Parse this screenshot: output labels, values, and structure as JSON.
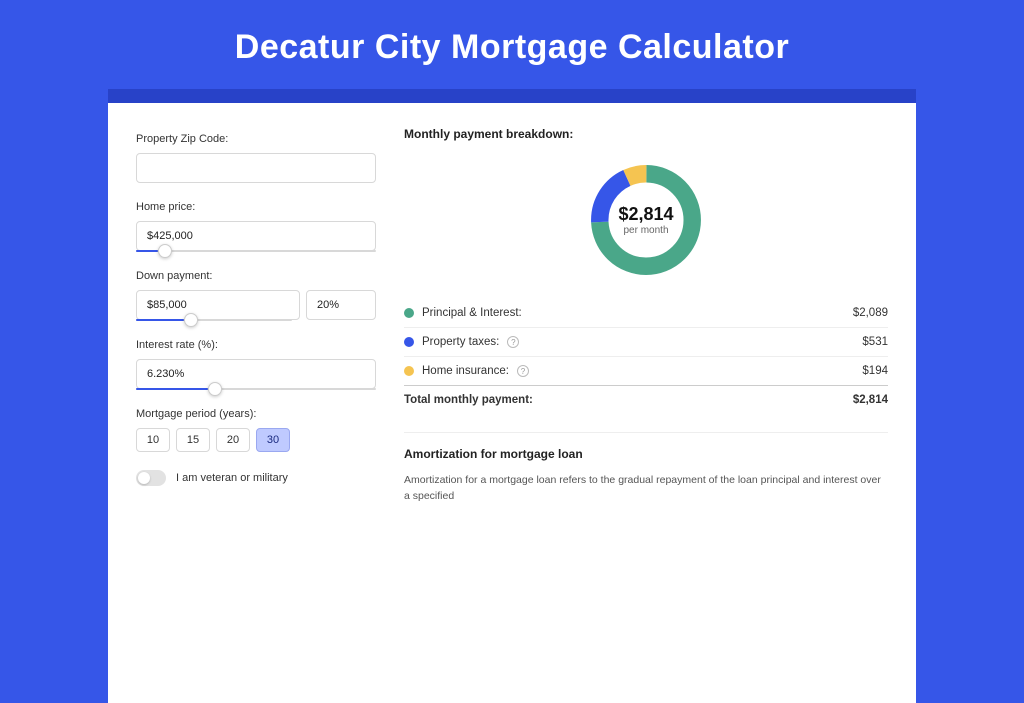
{
  "title": "Decatur City Mortgage Calculator",
  "form": {
    "zip": {
      "label": "Property Zip Code:",
      "value": ""
    },
    "price": {
      "label": "Home price:",
      "value": "$425,000",
      "slider_pct": 9
    },
    "down": {
      "label": "Down payment:",
      "value": "$85,000",
      "pct": "20%",
      "slider_pct": 20
    },
    "rate": {
      "label": "Interest rate (%):",
      "value": "6.230%",
      "slider_pct": 30
    },
    "period": {
      "label": "Mortgage period (years):",
      "options": [
        "10",
        "15",
        "20",
        "30"
      ],
      "selected": "30"
    },
    "veteran": {
      "label": "I am veteran or military"
    }
  },
  "breakdown": {
    "title": "Monthly payment breakdown:",
    "center_amount": "$2,814",
    "center_sub": "per month",
    "rows": {
      "pi": {
        "label": "Principal & Interest:",
        "value": "$2,089"
      },
      "tax": {
        "label": "Property taxes:",
        "value": "$531"
      },
      "ins": {
        "label": "Home insurance:",
        "value": "$194"
      },
      "tot": {
        "label": "Total monthly payment:",
        "value": "$2,814"
      }
    }
  },
  "amort": {
    "title": "Amortization for mortgage loan",
    "text": "Amortization for a mortgage loan refers to the gradual repayment of the loan principal and interest over a specified"
  },
  "chart_data": {
    "type": "pie",
    "title": "Monthly payment breakdown",
    "series": [
      {
        "name": "Principal & Interest",
        "value": 2089,
        "color": "#4aa789"
      },
      {
        "name": "Property taxes",
        "value": 531,
        "color": "#3656e8"
      },
      {
        "name": "Home insurance",
        "value": 194,
        "color": "#f5c451"
      }
    ],
    "total": 2814,
    "center_label": "$2,814 per month"
  }
}
